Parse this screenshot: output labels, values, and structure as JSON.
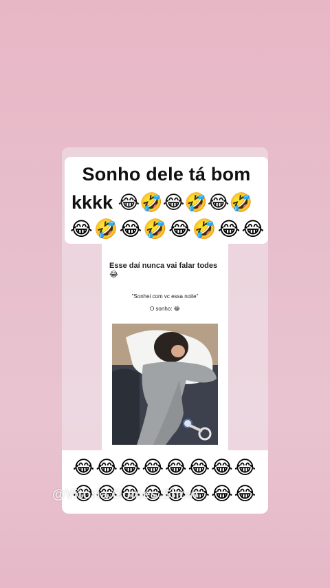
{
  "story": {
    "caption_top": {
      "line1": "Sonho dele tá bom",
      "line2": "kkkk 😂🤣😂🤣😂🤣",
      "line3": "😂🤣😂🤣😂🤣😂😂"
    },
    "post": {
      "title": "Esse daí nunca vai falar todes 😂",
      "quote": "\"Sonhei com vc essa noite\"",
      "dream_label": "O sonho: 😂"
    },
    "caption_bottom": {
      "row1": "😂😂😂😂😂😂😂😂",
      "row2": "😂😂😂😂😂😂😂😂"
    },
    "watermark": "@Vitoria.Gomes.Show"
  },
  "colors": {
    "background": "#e8b7c6",
    "card": "#ffffff",
    "text": "#111111"
  }
}
